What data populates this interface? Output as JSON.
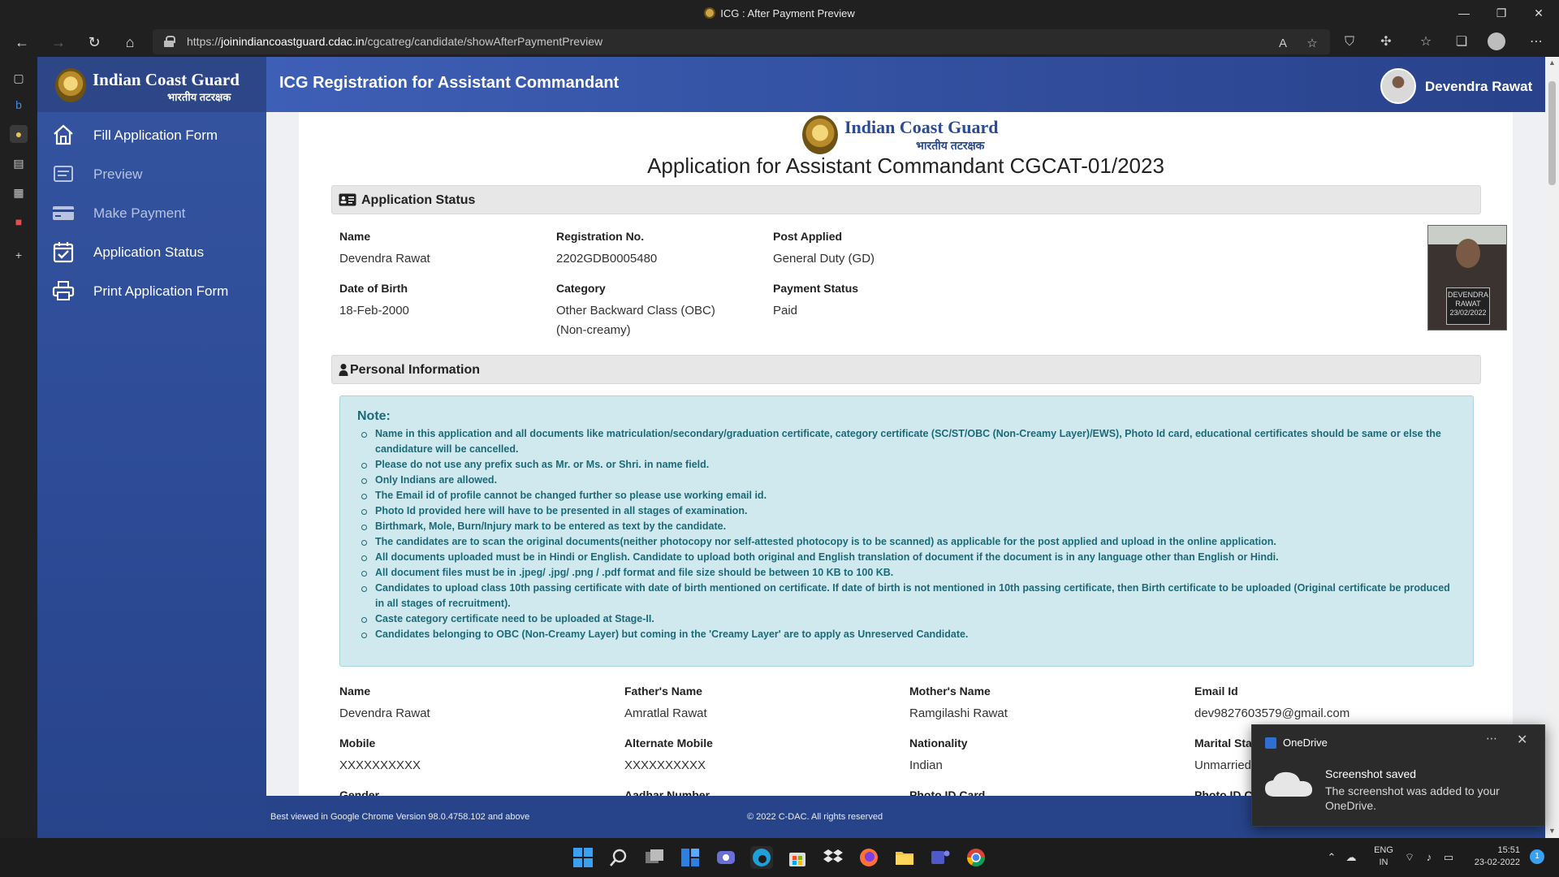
{
  "window": {
    "title": "ICG : After Payment Preview",
    "controls": [
      "—",
      "❐",
      "✕"
    ]
  },
  "browser": {
    "url_prefix": "https://",
    "url_host": "joinindiancoastguard.cdac.in",
    "url_path": "/cgcatreg/candidate/showAfterPaymentPreview"
  },
  "sidebar": {
    "brand_title": "Indian Coast Guard",
    "brand_subtitle": "भारतीय तटरक्षक",
    "items": [
      {
        "label": "Fill Application Form",
        "icon": "home-icon",
        "enabled": true
      },
      {
        "label": "Preview",
        "icon": "preview-icon",
        "enabled": false
      },
      {
        "label": "Make Payment",
        "icon": "credit-card-icon",
        "enabled": false
      },
      {
        "label": "Application Status",
        "icon": "calendar-check-icon",
        "enabled": true
      },
      {
        "label": "Print Application Form",
        "icon": "printer-icon",
        "enabled": true
      }
    ]
  },
  "header": {
    "title": "ICG Registration for Assistant Commandant",
    "user_name": "Devendra Rawat"
  },
  "page": {
    "brand_title": "Indian Coast Guard",
    "brand_subtitle": "भारतीय तटरक्षक",
    "title": "Application for Assistant Commandant CGCAT-01/2023"
  },
  "application_status": {
    "heading": "Application Status",
    "fields": [
      {
        "label": "Name",
        "value": "Devendra Rawat"
      },
      {
        "label": "Registration No.",
        "value": "2202GDB0005480"
      },
      {
        "label": "Post Applied",
        "value": "General Duty (GD)"
      },
      {
        "label": "Date of Birth",
        "value": "18-Feb-2000"
      },
      {
        "label": "Category",
        "value": "Other Backward Class (OBC) (Non-creamy)"
      },
      {
        "label": "Payment Status",
        "value": "Paid"
      }
    ],
    "photo_board": "DEVENDRA RAWAT 23/02/2022"
  },
  "personal_information": {
    "heading": "Personal Information",
    "note_title": "Note:",
    "notes": [
      "Name in this application and all documents like matriculation/secondary/graduation certificate, category certificate (SC/ST/OBC (Non-Creamy Layer)/EWS), Photo Id card, educational certificates should be same or else the candidature will be cancelled.",
      "Please do not use any prefix such as Mr. or Ms. or Shri. in name field.",
      "Only Indians are allowed.",
      "The Email id of profile cannot be changed further so please use working email id.",
      "Photo Id provided here will have to be presented in all stages of examination.",
      "Birthmark, Mole, Burn/Injury mark to be entered as text by the candidate.",
      "The candidates are to scan the original documents(neither photocopy nor self-attested photocopy is to be scanned) as applicable for the post applied and upload in the online application.",
      "All documents uploaded must be in Hindi or English. Candidate to upload both original and English translation of document if the document is in any language other than English or Hindi.",
      "All document files must be in .jpeg/ .jpg/ .png / .pdf format and file size should be between 10 KB to 100 KB.",
      "Candidates to upload class 10th passing certificate with date of birth mentioned on certificate. If date of birth is not mentioned in 10th passing certificate, then Birth certificate to be uploaded (Original certificate be produced in all stages of recruitment).",
      "Caste category certificate need to be uploaded at Stage-II.",
      "Candidates belonging to OBC (Non-Creamy Layer) but coming in the 'Creamy Layer' are to apply as Unreserved Candidate."
    ],
    "fields": [
      {
        "label": "Name",
        "value": "Devendra Rawat"
      },
      {
        "label": "Father's Name",
        "value": "Amratlal Rawat"
      },
      {
        "label": "Mother's Name",
        "value": "Ramgilashi Rawat"
      },
      {
        "label": "Email Id",
        "value": "dev9827603579@gmail.com"
      },
      {
        "label": "Mobile",
        "value": "XXXXXXXXXX"
      },
      {
        "label": "Alternate Mobile",
        "value": "XXXXXXXXXX"
      },
      {
        "label": "Nationality",
        "value": "Indian"
      },
      {
        "label": "Marital Status",
        "value": "Unmarried"
      },
      {
        "label": "Gender",
        "value": ""
      },
      {
        "label": "Aadhar Number",
        "value": ""
      },
      {
        "label": "Photo ID Card",
        "value": ""
      },
      {
        "label": "Photo ID Card",
        "value": ""
      }
    ]
  },
  "footer": {
    "left": "Best viewed in Google Chrome Version 98.0.4758.102 and above",
    "center": "© 2022 C-DAC. All rights reserved"
  },
  "toast": {
    "app": "OneDrive",
    "title": "Screenshot saved",
    "body": "The screenshot was added to your OneDrive."
  },
  "taskbar": {
    "lang_top": "ENG",
    "lang_bottom": "IN",
    "time": "15:51",
    "date": "23-02-2022",
    "notification_count": "1"
  },
  "colors": {
    "sidebar": "#2c4a95",
    "header": "#3e5fb6",
    "note_bg": "#cfe9ee",
    "note_text": "#1c6a78"
  }
}
